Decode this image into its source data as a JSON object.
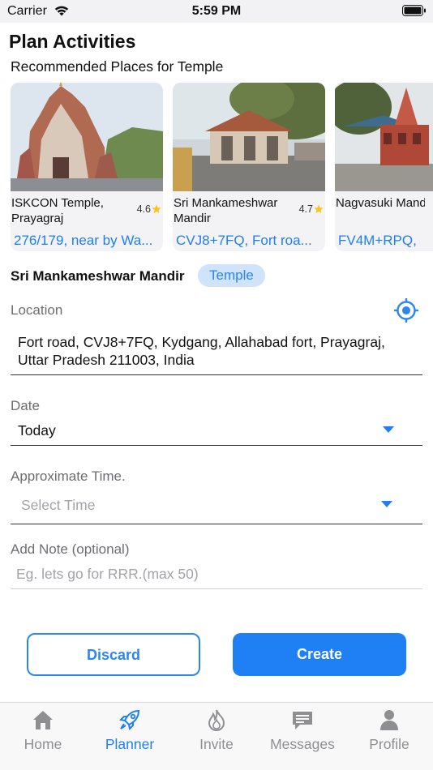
{
  "status_bar": {
    "carrier": "Carrier",
    "time": "5:59 PM"
  },
  "header": {
    "title": "Plan Activities",
    "subtitle": "Recommended Places for Temple"
  },
  "places": [
    {
      "name": "ISKCON Temple, Prayagraj",
      "rating": "4.6",
      "address": "276/179, near by Wa..."
    },
    {
      "name": "Sri Mankameshwar Mandir",
      "rating": "4.7",
      "address": "CVJ8+7FQ, Fort roa..."
    },
    {
      "name": "Nagvasuki Mand",
      "rating": "",
      "address": "FV4M+RPQ, "
    }
  ],
  "selected": {
    "name": "Sri Mankameshwar Mandir",
    "category": "Temple"
  },
  "form": {
    "location": {
      "label": "Location",
      "value": "Fort road, CVJ8+7FQ, Kydgang, Allahabad fort, Prayagraj, Uttar Pradesh 211003, India"
    },
    "date": {
      "label": "Date",
      "value": "Today"
    },
    "time": {
      "label": "Approximate Time.",
      "placeholder": "Select Time"
    },
    "note": {
      "label": "Add Note (optional)",
      "placeholder": "Eg. lets go for RRR.(max 50)"
    }
  },
  "actions": {
    "discard": "Discard",
    "create": "Create"
  },
  "tabs": [
    {
      "label": "Home",
      "icon": "home-icon"
    },
    {
      "label": "Planner",
      "icon": "rocket-icon",
      "active": true
    },
    {
      "label": "Invite",
      "icon": "flame-icon"
    },
    {
      "label": "Messages",
      "icon": "chat-icon"
    },
    {
      "label": "Profile",
      "icon": "person-icon"
    }
  ],
  "colors": {
    "accent": "#1f7ff5",
    "badge_bg": "#cfe3fb",
    "star": "#f5c518",
    "inactive": "#8e8e93"
  }
}
